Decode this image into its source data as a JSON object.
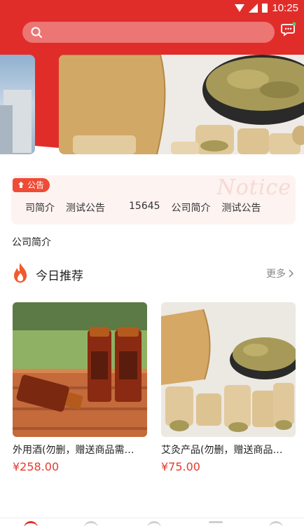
{
  "status_bar": {
    "time": "10:25"
  },
  "search": {
    "placeholder": ""
  },
  "notice": {
    "badge": "公告",
    "watermark": "Notice",
    "items": [
      "司简介",
      "测试公告",
      "15645",
      "公司简介",
      "测试公告"
    ]
  },
  "company_intro": "公司简介",
  "recommend": {
    "title": "今日推荐",
    "more": "更多",
    "products": [
      {
        "name": "外用酒(勿删，赠送商品需…",
        "price": "¥258.00"
      },
      {
        "name": "艾灸产品(勿删，赠送商品…",
        "price": "¥75.00"
      }
    ]
  },
  "colors": {
    "brand_red": "#e12d2a",
    "price_red": "#e63a2e",
    "notice_bg": "#fdf3f1"
  },
  "icons": [
    "search-icon",
    "message-icon",
    "notice-bell-icon",
    "fire-icon",
    "chevron-right-icon",
    "home-icon",
    "category-icon",
    "cart-icon",
    "user-icon"
  ]
}
